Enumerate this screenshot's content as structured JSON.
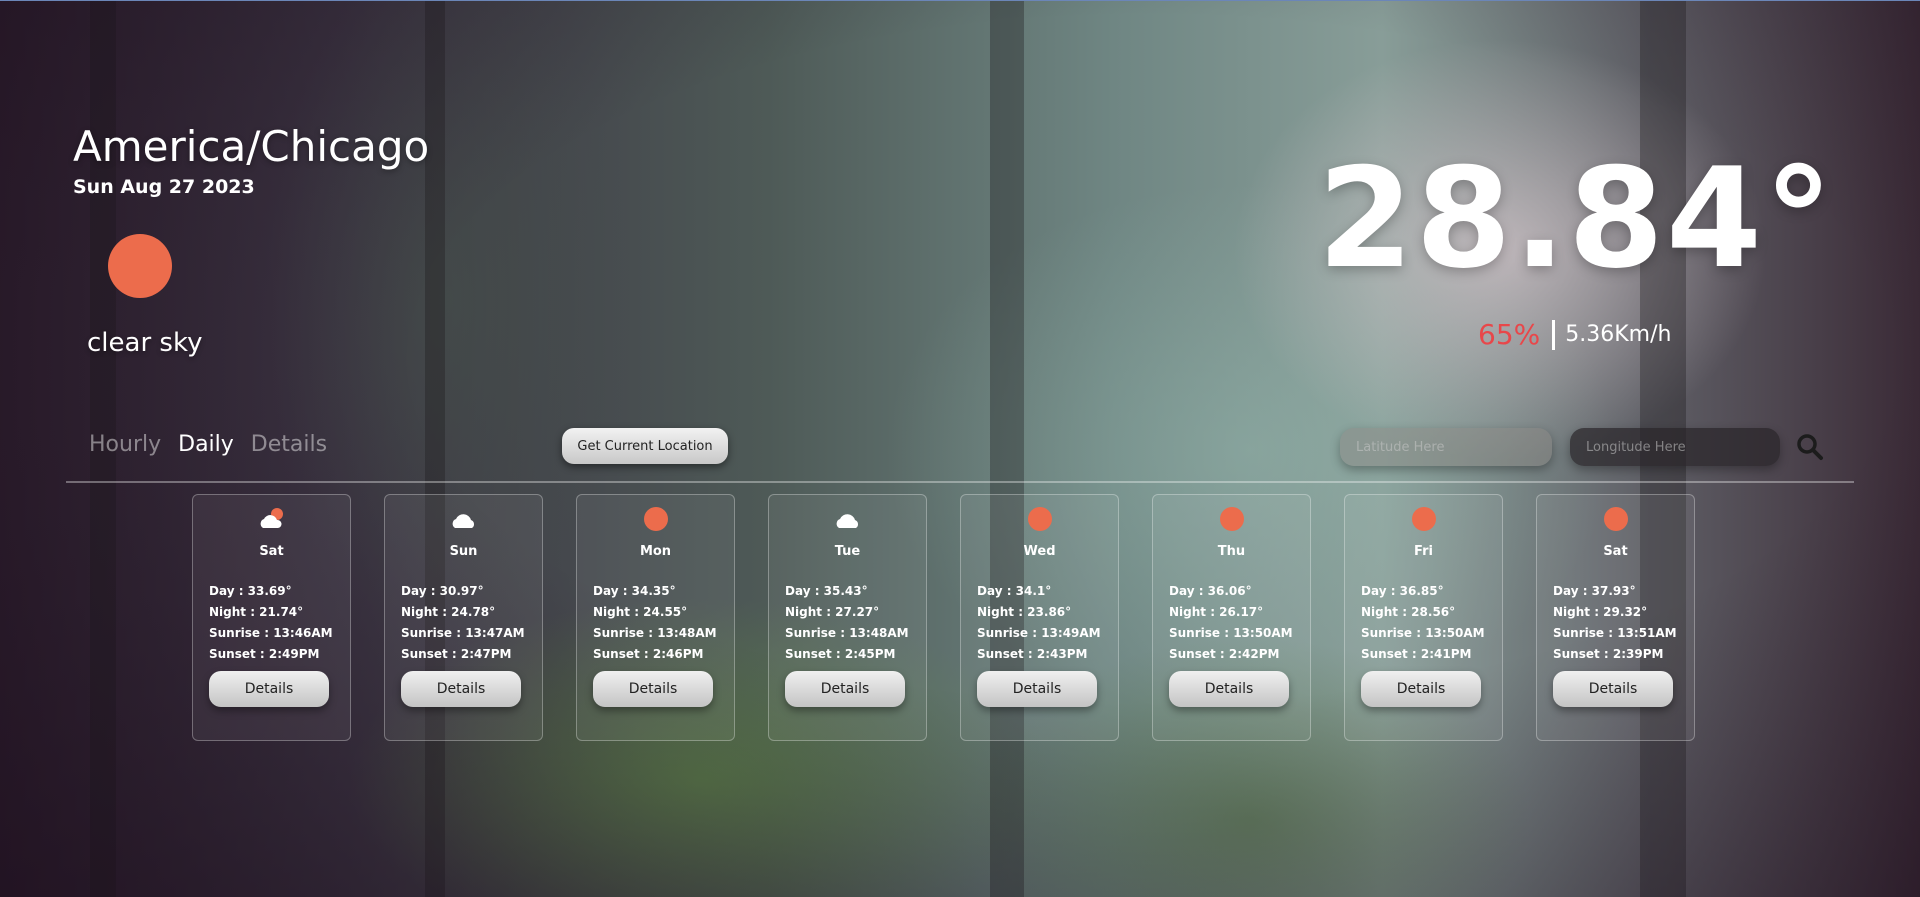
{
  "location": {
    "timezone": "America/Chicago",
    "date": "Sun Aug 27 2023"
  },
  "current": {
    "icon": "sun-icon",
    "condition": "clear sky",
    "temperature": "28.84°",
    "humidity": "65%",
    "wind": "5.36Km/h"
  },
  "tabs": [
    {
      "label": "Hourly",
      "active": false
    },
    {
      "label": "Daily",
      "active": true
    },
    {
      "label": "Details",
      "active": false
    }
  ],
  "controls": {
    "current_location_label": "Get Current Location",
    "latitude_placeholder": "Latitude Here",
    "longitude_placeholder": "Longitude Here",
    "search_icon": "search-icon"
  },
  "colors": {
    "sun": "#ec6c4c",
    "humidity": "#e8474a"
  },
  "forecast": [
    {
      "day": "Sat",
      "icon": "cloud-sun-icon",
      "day_temp": "Day : 33.69°",
      "night_temp": "Night : 21.74°",
      "sunrise": "Sunrise : 13:46AM",
      "sunset": "Sunset : 2:49PM",
      "button": "Details"
    },
    {
      "day": "Sun",
      "icon": "cloud-icon",
      "day_temp": "Day : 30.97°",
      "night_temp": "Night : 24.78°",
      "sunrise": "Sunrise : 13:47AM",
      "sunset": "Sunset : 2:47PM",
      "button": "Details"
    },
    {
      "day": "Mon",
      "icon": "sun-icon",
      "day_temp": "Day : 34.35°",
      "night_temp": "Night : 24.55°",
      "sunrise": "Sunrise : 13:48AM",
      "sunset": "Sunset : 2:46PM",
      "button": "Details"
    },
    {
      "day": "Tue",
      "icon": "cloud-icon",
      "day_temp": "Day : 35.43°",
      "night_temp": "Night : 27.27°",
      "sunrise": "Sunrise : 13:48AM",
      "sunset": "Sunset : 2:45PM",
      "button": "Details"
    },
    {
      "day": "Wed",
      "icon": "sun-icon",
      "day_temp": "Day : 34.1°",
      "night_temp": "Night : 23.86°",
      "sunrise": "Sunrise : 13:49AM",
      "sunset": "Sunset : 2:43PM",
      "button": "Details"
    },
    {
      "day": "Thu",
      "icon": "sun-icon",
      "day_temp": "Day : 36.06°",
      "night_temp": "Night : 26.17°",
      "sunrise": "Sunrise : 13:50AM",
      "sunset": "Sunset : 2:42PM",
      "button": "Details"
    },
    {
      "day": "Fri",
      "icon": "sun-icon",
      "day_temp": "Day : 36.85°",
      "night_temp": "Night : 28.56°",
      "sunrise": "Sunrise : 13:50AM",
      "sunset": "Sunset : 2:41PM",
      "button": "Details"
    },
    {
      "day": "Sat",
      "icon": "sun-icon",
      "day_temp": "Day : 37.93°",
      "night_temp": "Night : 29.32°",
      "sunrise": "Sunrise : 13:51AM",
      "sunset": "Sunset : 2:39PM",
      "button": "Details"
    }
  ]
}
